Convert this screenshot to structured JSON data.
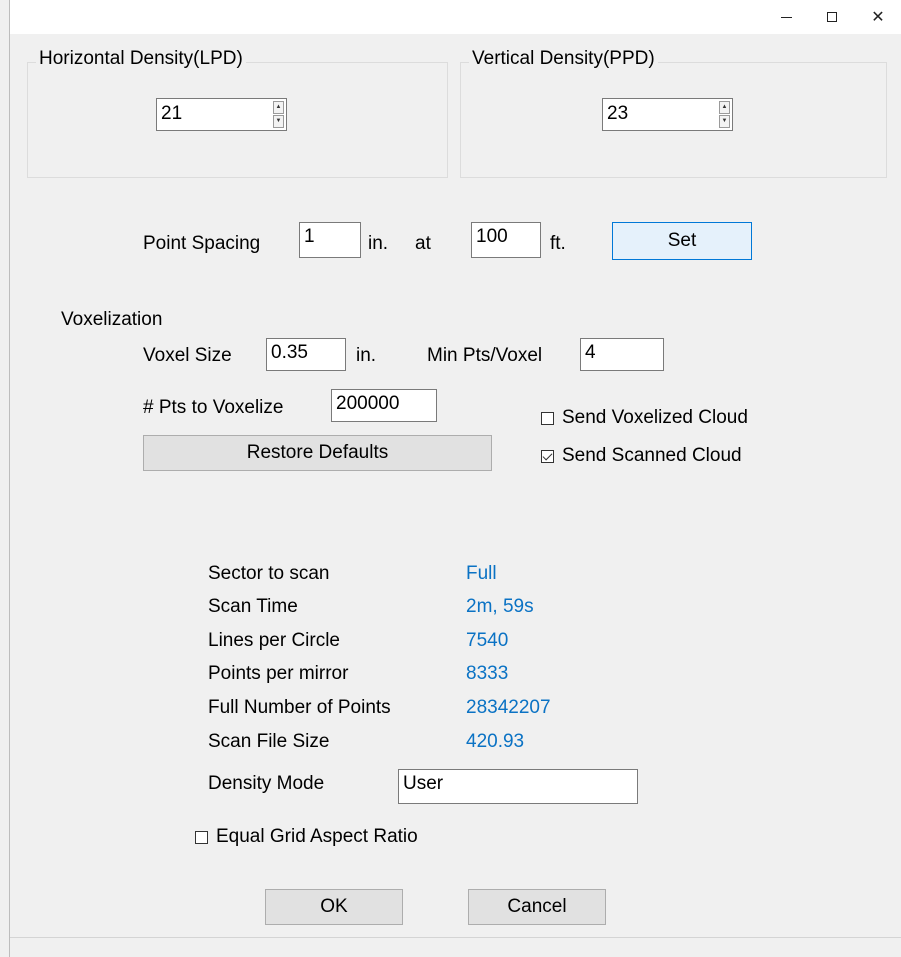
{
  "horizontal_density": {
    "title": "Horizontal Density(LPD)",
    "value": "21"
  },
  "vertical_density": {
    "title": "Vertical Density(PPD)",
    "value": "23"
  },
  "point_spacing": {
    "label": "Point Spacing",
    "spacing_value": "1",
    "spacing_unit": "in.",
    "at_label": "at",
    "distance_value": "100",
    "distance_unit": "ft.",
    "set_label": "Set"
  },
  "voxelization": {
    "heading": "Voxelization",
    "voxel_size_label": "Voxel Size",
    "voxel_size_value": "0.35",
    "voxel_size_unit": "in.",
    "min_pts_label": "Min Pts/Voxel",
    "min_pts_value": "4",
    "pts_to_voxelize_label": "# Pts to Voxelize",
    "pts_to_voxelize_value": "200000",
    "restore_label": "Restore Defaults",
    "send_voxelized_label": "Send Voxelized Cloud",
    "send_voxelized_checked": false,
    "send_scanned_label": "Send Scanned Cloud",
    "send_scanned_checked": true
  },
  "info": [
    {
      "label": "Sector to scan",
      "value": "Full"
    },
    {
      "label": "Scan Time",
      "value": "2m, 59s"
    },
    {
      "label": "Lines per Circle",
      "value": "7540"
    },
    {
      "label": "Points per mirror",
      "value": "8333"
    },
    {
      "label": "Full Number of Points",
      "value": "28342207"
    },
    {
      "label": "Scan File Size",
      "value": "420.93"
    }
  ],
  "density_mode": {
    "label": "Density Mode",
    "value": "User"
  },
  "equal_grid": {
    "label": "Equal Grid Aspect Ratio",
    "checked": false
  },
  "buttons": {
    "ok": "OK",
    "cancel": "Cancel"
  },
  "colors": {
    "value_blue": "#0a72c4",
    "set_border": "#0078d7"
  }
}
